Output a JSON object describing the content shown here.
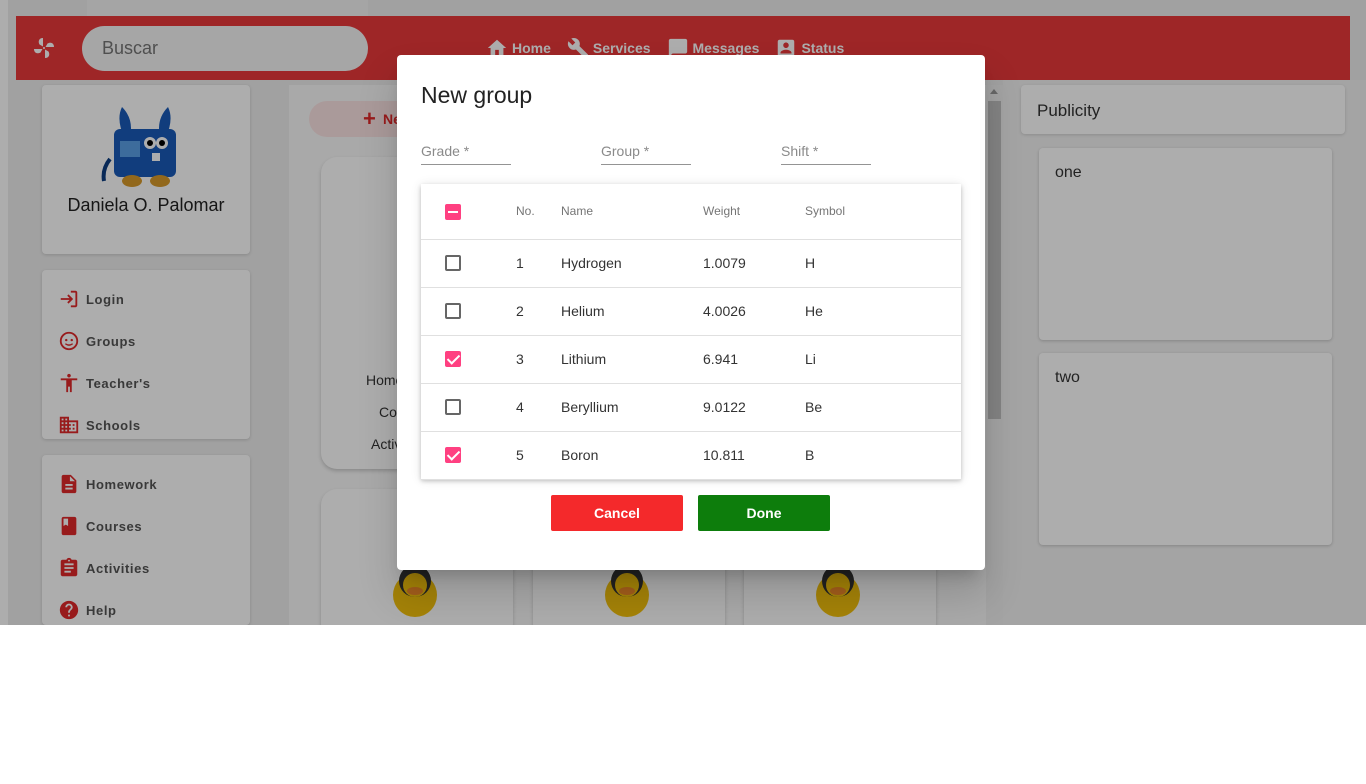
{
  "search": {
    "placeholder": "Buscar"
  },
  "nav": [
    {
      "label": "Home",
      "icon": "home-icon"
    },
    {
      "label": "Services",
      "icon": "wrench-icon"
    },
    {
      "label": "Messages",
      "icon": "message-icon"
    },
    {
      "label": "Status",
      "icon": "account-box-icon"
    }
  ],
  "profile": {
    "name": "Daniela O. Palomar"
  },
  "menu1": [
    {
      "label": "Login",
      "icon": "login-icon"
    },
    {
      "label": "Groups",
      "icon": "face-icon"
    },
    {
      "label": "Teacher's",
      "icon": "person-icon"
    },
    {
      "label": "Schools",
      "icon": "building-icon"
    }
  ],
  "menu2": [
    {
      "label": "Homework",
      "icon": "document-icon"
    },
    {
      "label": "Courses",
      "icon": "book-icon"
    },
    {
      "label": "Activities",
      "icon": "clipboard-icon"
    },
    {
      "label": "Help",
      "icon": "help-icon"
    }
  ],
  "main": {
    "new_button": "Ne",
    "card_texts": [
      "Home",
      "Co",
      "Activ"
    ]
  },
  "publicity": {
    "title": "Publicity",
    "items": [
      "one",
      "two"
    ]
  },
  "dialog": {
    "title": "New group",
    "fields": [
      "Grade *",
      "Group *",
      "Shift *"
    ],
    "columns": [
      "No.",
      "Name",
      "Weight",
      "Symbol"
    ],
    "rows": [
      {
        "no": "1",
        "name": "Hydrogen",
        "weight": "1.0079",
        "symbol": "H",
        "checked": false
      },
      {
        "no": "2",
        "name": "Helium",
        "weight": "4.0026",
        "symbol": "He",
        "checked": false
      },
      {
        "no": "3",
        "name": "Lithium",
        "weight": "6.941",
        "symbol": "Li",
        "checked": true
      },
      {
        "no": "4",
        "name": "Beryllium",
        "weight": "9.0122",
        "symbol": "Be",
        "checked": false
      },
      {
        "no": "5",
        "name": "Boron",
        "weight": "10.811",
        "symbol": "B",
        "checked": true
      }
    ],
    "cancel_label": "Cancel",
    "done_label": "Done"
  },
  "colors": {
    "accent": "#e9383a",
    "checkbox": "#ff4081",
    "cancel": "#f4292b",
    "done": "#0d7d0c"
  }
}
